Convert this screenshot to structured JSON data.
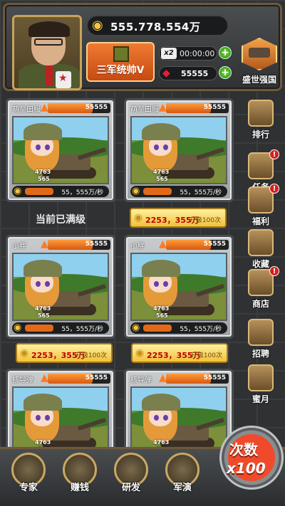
{
  "header": {
    "gold": "555.778.554万",
    "rank_label": "三军统帅V",
    "multiplier": "x2",
    "timer": "00:00:00",
    "gems": "55555",
    "country_label": "盛世强国"
  },
  "status_text": "当前已满级",
  "cards": [
    {
      "name": "萌至田服",
      "power": "55555",
      "level1": "4763",
      "level2": "565",
      "price": "55，555万/秒"
    },
    {
      "name": "萌至田服",
      "power": "55555",
      "level1": "4763",
      "level2": "565",
      "price": "55，555万/秒"
    },
    {
      "name": "小胖",
      "power": "55555",
      "level1": "4763",
      "level2": "565",
      "price": "55，555万/秒"
    },
    {
      "name": "小胖",
      "power": "55555",
      "level1": "4763",
      "level2": "565",
      "price": "55，555万/秒"
    },
    {
      "name": "核导弹",
      "power": "55555",
      "level1": "4763",
      "level2": "565",
      "price": ""
    },
    {
      "name": "核导弹",
      "power": "55555",
      "level1": "4763",
      "level2": "565",
      "price": ""
    }
  ],
  "upgrades": [
    {
      "amount": "2253，355万",
      "sub": "升级100次"
    },
    {
      "amount": "2253，355万",
      "sub": "升级100次"
    },
    {
      "amount": "2253，355万",
      "sub": "升级100次"
    }
  ],
  "side_menu": [
    {
      "label": "排行",
      "badge": ""
    },
    {
      "label": "任务",
      "badge": "!"
    },
    {
      "label": "福利",
      "badge": "!"
    },
    {
      "label": "收藏",
      "badge": ""
    },
    {
      "label": "商店",
      "badge": "!"
    },
    {
      "label": "招聘",
      "badge": ""
    },
    {
      "label": "蜜月",
      "badge": ""
    }
  ],
  "bottom_nav": [
    {
      "label": "专家"
    },
    {
      "label": "赚钱"
    },
    {
      "label": "研发"
    },
    {
      "label": "军演"
    }
  ],
  "times_button": {
    "line1": "次数",
    "line2": "x100"
  },
  "colors": {
    "accent": "#f04a2a",
    "gold": "#f5c542",
    "gem": "#e0203a",
    "upgrade_bg": "#f2c23a"
  }
}
